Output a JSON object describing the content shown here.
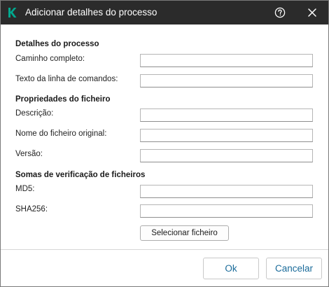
{
  "window": {
    "title": "Adicionar detalhes do processo",
    "logo_icon": "kaspersky-k-icon",
    "brand_color": "#00a88e",
    "help_icon": "help-circle-icon",
    "close_icon": "close-icon"
  },
  "process_details": {
    "heading": "Detalhes do processo",
    "full_path_label": "Caminho completo:",
    "full_path_value": "",
    "command_line_label": "Texto da linha de comandos:",
    "command_line_value": ""
  },
  "file_properties": {
    "heading": "Propriedades do ficheiro",
    "description_label": "Descrição:",
    "description_value": "",
    "original_name_label": "Nome do ficheiro original:",
    "original_name_value": "",
    "version_label": "Versão:",
    "version_value": ""
  },
  "checksums": {
    "heading": "Somas de verificação de ficheiros",
    "md5_label": "MD5:",
    "md5_value": "",
    "sha256_label": "SHA256:",
    "sha256_value": "",
    "select_file_label": "Selecionar ficheiro"
  },
  "footer": {
    "ok_label": "Ok",
    "cancel_label": "Cancelar",
    "accent_color": "#1a6b9a"
  }
}
